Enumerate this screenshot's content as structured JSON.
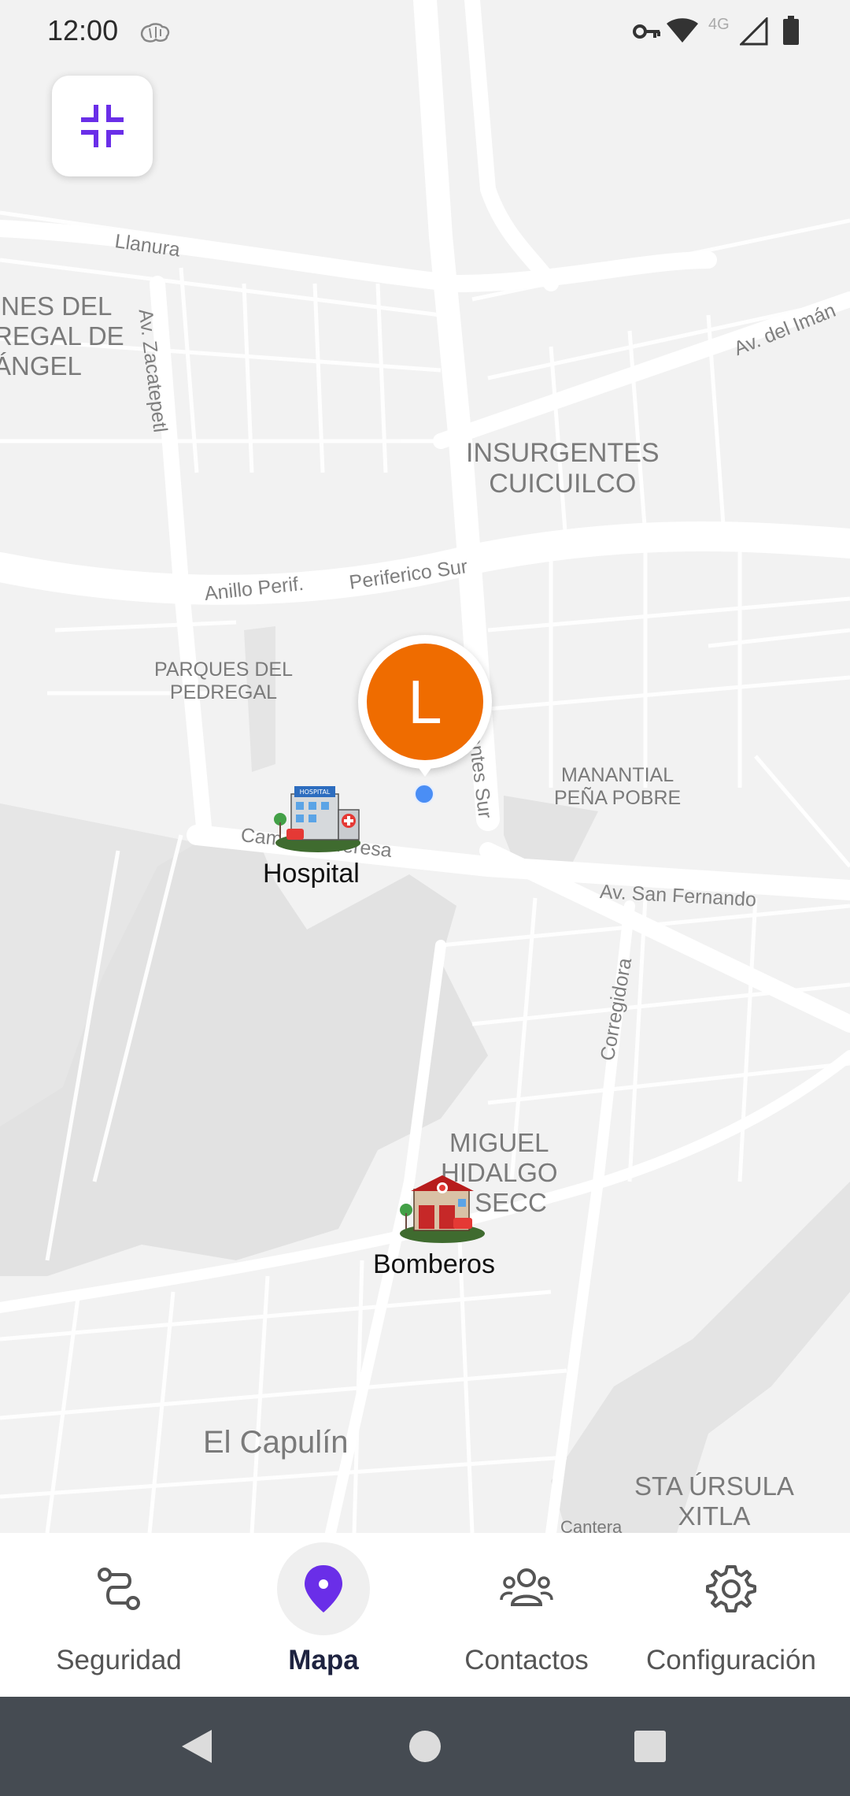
{
  "status_bar": {
    "time": "12:00",
    "network": "4G",
    "icons": [
      "brain-icon",
      "key-icon",
      "wifi-icon",
      "signal-icon",
      "battery-icon"
    ]
  },
  "map": {
    "collapse_button_icon": "fullscreen-exit-icon",
    "neighborhoods": [
      {
        "id": "jardines",
        "text": "INES DEL\nREGAL DE\nÁNGEL"
      },
      {
        "id": "insurgentes",
        "text": "INSURGENTES\nCUICUILCO"
      },
      {
        "id": "parques",
        "text": "PARQUES DEL\nPEDREGAL"
      },
      {
        "id": "manantial",
        "text": "MANANTIAL\nPEÑA POBRE"
      },
      {
        "id": "miguel",
        "text": "MIGUEL\nHIDALGO\nA SECC"
      },
      {
        "id": "capulin",
        "text": "El Capulín"
      },
      {
        "id": "ursula",
        "text": "STA ÚRSULA\nXITLA"
      },
      {
        "id": "cantera",
        "text": "Cantera"
      }
    ],
    "streets": [
      {
        "id": "llanura",
        "text": "Llanura"
      },
      {
        "id": "zacatepetl",
        "text": "Av. Zacatepetl"
      },
      {
        "id": "iman",
        "text": "Av. del Imán"
      },
      {
        "id": "anillo",
        "text": "Anillo Perif."
      },
      {
        "id": "periferico",
        "text": "Periferico Sur"
      },
      {
        "id": "insurgentes_sur",
        "text": "entes Sur"
      },
      {
        "id": "teresa",
        "text": "Cam. Sta. Teresa"
      },
      {
        "id": "san_fernando",
        "text": "Av. San Fernando"
      },
      {
        "id": "corregidora",
        "text": "Corregidora"
      }
    ],
    "user_marker": {
      "initial": "L",
      "color": "#ef6c00"
    },
    "pois": [
      {
        "id": "hospital",
        "label": "Hospital",
        "icon": "hospital-icon"
      },
      {
        "id": "bomberos",
        "label": "Bomberos",
        "icon": "fire-station-icon"
      }
    ]
  },
  "bottom_nav": {
    "items": [
      {
        "id": "seguridad",
        "label": "Seguridad",
        "icon": "route-icon",
        "active": false
      },
      {
        "id": "mapa",
        "label": "Mapa",
        "icon": "map-pin-icon",
        "active": true
      },
      {
        "id": "contactos",
        "label": "Contactos",
        "icon": "contacts-icon",
        "active": false
      },
      {
        "id": "configuracion",
        "label": "Configuración",
        "icon": "gear-icon",
        "active": false
      }
    ],
    "accent_color": "#6a2ee8"
  },
  "system_nav": {
    "icons": [
      "back-icon",
      "home-icon",
      "recents-icon"
    ]
  }
}
